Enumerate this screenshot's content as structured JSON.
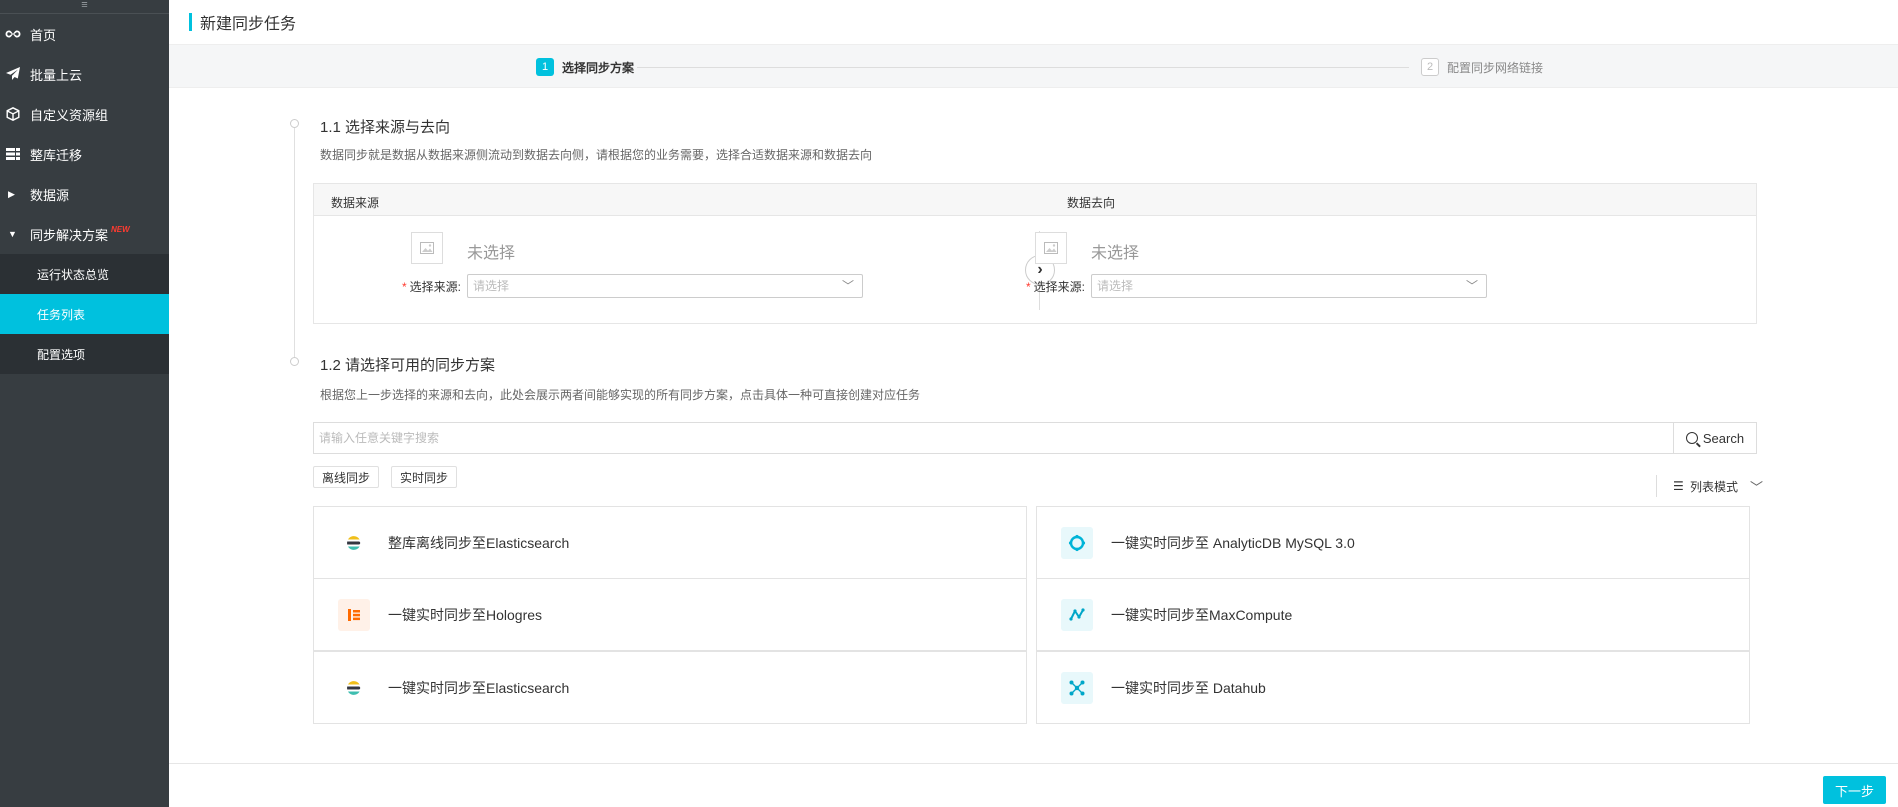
{
  "sidebar": {
    "toggle": "≡",
    "items": [
      {
        "label": "首页",
        "icon": "infinity-icon"
      },
      {
        "label": "批量上云",
        "icon": "paper-plane-icon"
      },
      {
        "label": "自定义资源组",
        "icon": "cube-icon"
      },
      {
        "label": "整库迁移",
        "icon": "database-grid-icon"
      },
      {
        "label": "数据源",
        "icon": "caret-right-icon"
      },
      {
        "label": "同步解决方案",
        "icon": "caret-down-icon",
        "badge": "NEW"
      }
    ],
    "sub_items": [
      {
        "label": "运行状态总览"
      },
      {
        "label": "任务列表",
        "active": true
      },
      {
        "label": "配置选项"
      }
    ]
  },
  "page": {
    "title": "新建同步任务"
  },
  "steps": [
    {
      "num": "1",
      "label": "选择同步方案",
      "active": true
    },
    {
      "num": "2",
      "label": "配置同步网络链接",
      "active": false
    }
  ],
  "section1": {
    "num": "1.1",
    "title": "选择来源与去向",
    "desc": "数据同步就是数据从数据来源侧流动到数据去向侧，请根据您的业务需要，选择合适数据来源和数据去向",
    "source_header": "数据来源",
    "target_header": "数据去向",
    "source": {
      "status": "未选择",
      "label": "选择来源:",
      "placeholder": "请选择"
    },
    "target": {
      "status": "未选择",
      "label": "选择来源:",
      "placeholder": "请选择"
    }
  },
  "section2": {
    "num": "1.2",
    "title": "请选择可用的同步方案",
    "desc": "根据您上一步选择的来源和去向，此处会展示两者间能够实现的所有同步方案，点击具体一种可直接创建对应任务",
    "search_placeholder": "请输入任意关键字搜索",
    "search_button": "Search",
    "tags": [
      "离线同步",
      "实时同步"
    ],
    "view_mode": "列表模式",
    "cards": [
      {
        "label": "整库离线同步至Elasticsearch",
        "icon": "elasticsearch-icon"
      },
      {
        "label": "一键实时同步至 AnalyticDB MySQL 3.0",
        "icon": "analyticdb-icon"
      },
      {
        "label": "一键实时同步至Hologres",
        "icon": "hologres-icon"
      },
      {
        "label": "一键实时同步至MaxCompute",
        "icon": "maxcompute-icon"
      },
      {
        "label": "一键实时同步至Elasticsearch",
        "icon": "elasticsearch-icon"
      },
      {
        "label": "一键实时同步至 Datahub",
        "icon": "datahub-icon"
      }
    ]
  },
  "footer": {
    "next_button": "下一步"
  },
  "colors": {
    "accent": "#00c1de",
    "sidebar_bg": "#373d41",
    "sidebar_sub_bg": "#2b3034",
    "required": "#ff3b30"
  }
}
